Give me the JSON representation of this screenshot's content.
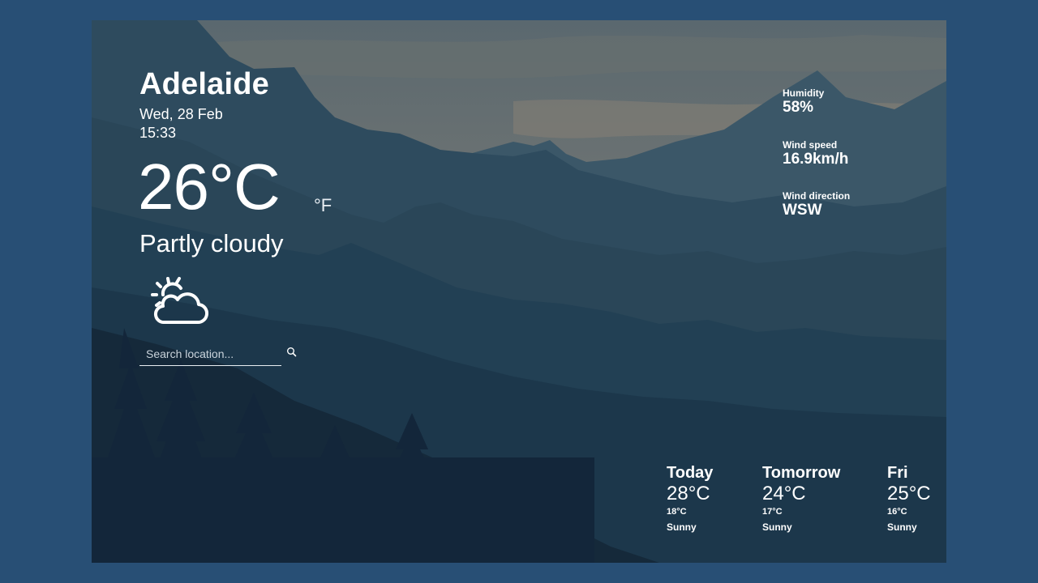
{
  "location": {
    "city": "Adelaide",
    "date": "Wed, 28 Feb",
    "time": "15:33"
  },
  "current": {
    "temperature": "26°C",
    "unit_toggle": "°F",
    "condition": "Partly cloudy",
    "icon": "partly-cloudy-icon"
  },
  "search": {
    "placeholder": "Search location...",
    "value": "",
    "icon": "search-icon"
  },
  "stats": [
    {
      "label": "Humidity",
      "value": "58%"
    },
    {
      "label": "Wind speed",
      "value": "16.9km/h"
    },
    {
      "label": "Wind direction",
      "value": "WSW"
    }
  ],
  "forecast": [
    {
      "day": "Today",
      "high": "28°C",
      "low": "18°C",
      "condition": "Sunny"
    },
    {
      "day": "Tomorrow",
      "high": "24°C",
      "low": "17°C",
      "condition": "Sunny"
    },
    {
      "day": "Fri",
      "high": "25°C",
      "low": "16°C",
      "condition": "Sunny"
    }
  ],
  "colors": {
    "page_background": "#284f75",
    "sky_top": "#5c6a70",
    "sky_glow": "#8d8678",
    "foreground": "#13283a",
    "text": "#ffffff"
  }
}
